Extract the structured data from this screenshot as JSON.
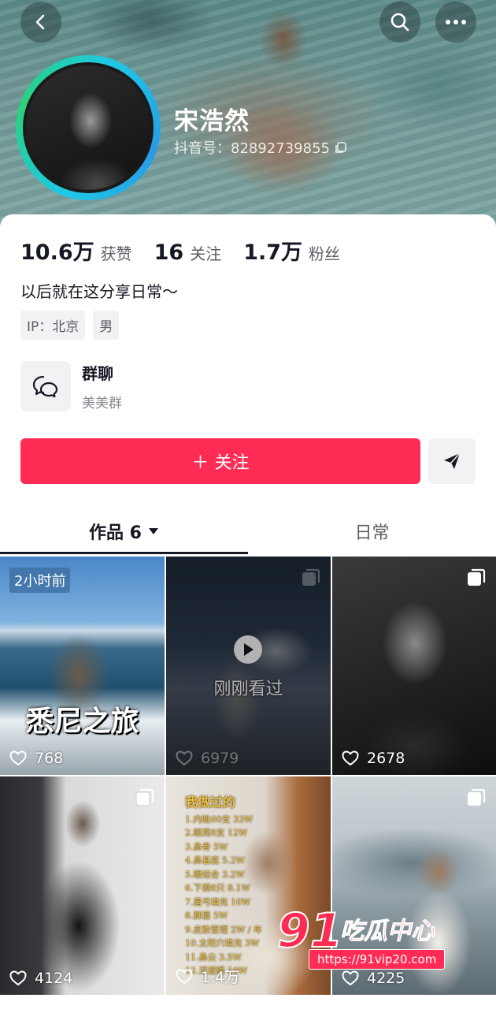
{
  "profile": {
    "nickname": "宋浩然",
    "account_id": "抖音号：82892739855",
    "bio": "以后就在这分享日常～",
    "tags": [
      "IP：北京",
      "男"
    ]
  },
  "stats": [
    {
      "value": "10.6万",
      "label": "获赞"
    },
    {
      "value": "16",
      "label": "关注"
    },
    {
      "value": "1.7万",
      "label": "粉丝"
    }
  ],
  "group_chat": {
    "title": "群聊",
    "subtitle": "美美群"
  },
  "actions": {
    "follow_label": "＋ 关注"
  },
  "tabs": {
    "works_label": "作品 6",
    "daily_label": "日常"
  },
  "videos": [
    {
      "likes": "768",
      "badge": "2小时前",
      "caption": "悉尼之旅"
    },
    {
      "likes": "6979",
      "overlay": "刚刚看过"
    },
    {
      "likes": "2678"
    },
    {
      "likes": "4124"
    },
    {
      "likes": "1.4万",
      "overlay_title": "我做过的",
      "overlay_lines": [
        "1.内眦60支 33W",
        "2.眼周8支 12W",
        "3.鼻骨 5W",
        "4.鼻基底 5.2W",
        "5.眼综合 3.2W",
        "6.下颌8只 8.1W",
        "7.眉弓填充 10W",
        "8.脚眉 5W",
        "9.皮肤管理 2W / 年",
        "10.太阳穴填充 3W",
        "11.鼻尖 3.5W",
        "12.深邃眼 10W"
      ]
    },
    {
      "likes": "4225"
    }
  ],
  "watermark": {
    "number": "91",
    "text": "吃瓜中心",
    "url": "https://91vip20.com"
  }
}
